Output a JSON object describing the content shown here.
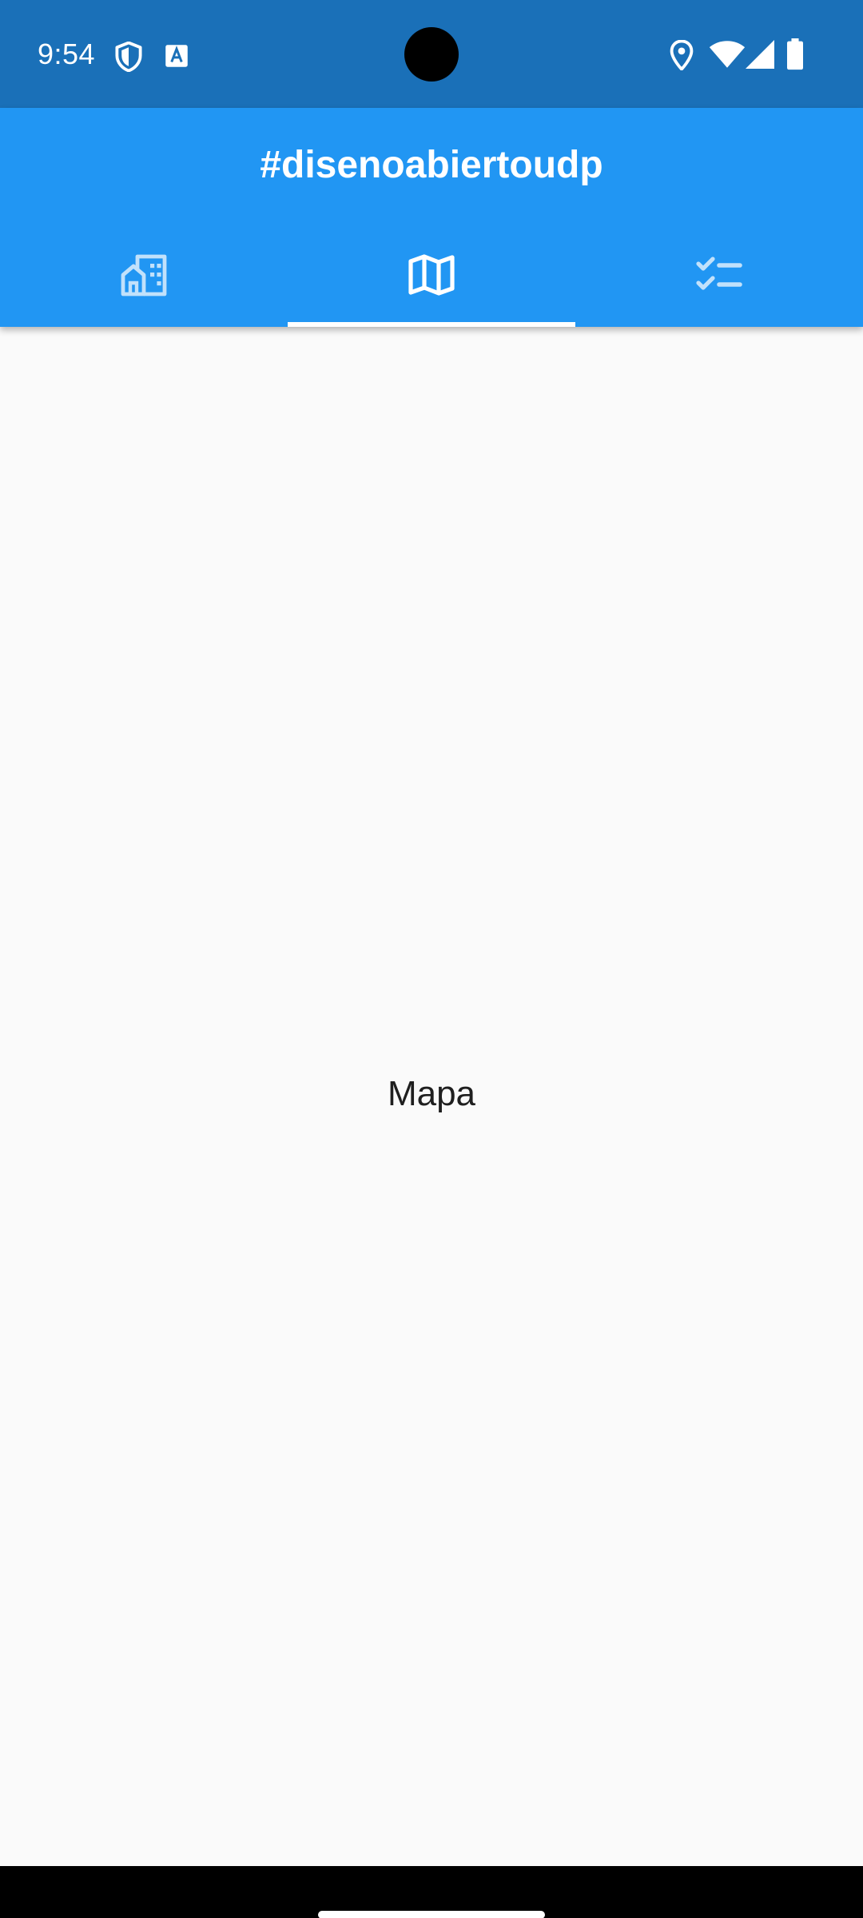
{
  "status_bar": {
    "time": "9:54",
    "left_icons": [
      "shield-icon",
      "translate-app-icon"
    ],
    "right_icons": [
      "location-icon",
      "wifi-icon",
      "cellular-signal-icon",
      "battery-icon"
    ],
    "background": "#1a70b8"
  },
  "app_bar": {
    "title": "#disenoabiertoudp",
    "background": "#2196f3",
    "tabs": [
      {
        "icon": "buildings-icon",
        "selected": false
      },
      {
        "icon": "map-icon",
        "selected": true
      },
      {
        "icon": "checklist-icon",
        "selected": false
      }
    ]
  },
  "content": {
    "label": "Mapa"
  }
}
